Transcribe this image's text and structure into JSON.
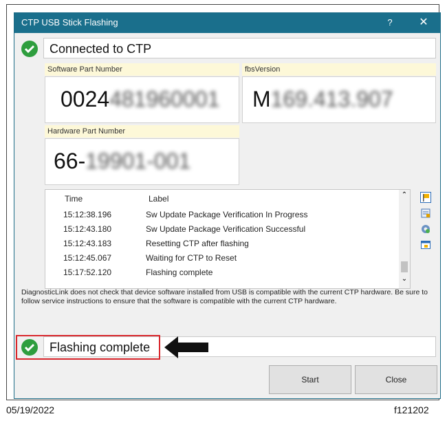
{
  "window": {
    "title": "CTP USB Stick Flashing",
    "help_label": "?",
    "close_label": "✕"
  },
  "status_top": {
    "text": "Connected to CTP"
  },
  "software_part": {
    "label": "Software Part Number",
    "value_visible": "0024",
    "value_blurred": "481960001"
  },
  "fbs_version": {
    "label": "fbsVersion",
    "value_visible": "M",
    "value_blurred": "169.413.907"
  },
  "hardware_part": {
    "label": "Hardware Part Number",
    "value_visible": "66-",
    "value_blurred": "19901-001"
  },
  "log": {
    "columns": [
      "Time",
      "Label"
    ],
    "rows": [
      {
        "time": "15:12:38.196",
        "label": "Sw Update Package Verification In Progress"
      },
      {
        "time": "15:12:43.180",
        "label": "Sw Update Package Verification Successful"
      },
      {
        "time": "15:12:43.183",
        "label": "Resetting CTP after flashing"
      },
      {
        "time": "15:12:45.067",
        "label": "Waiting for CTP to Reset"
      },
      {
        "time": "15:17:52.120",
        "label": "Flashing complete"
      }
    ],
    "scroll_up": "⌃",
    "scroll_down": "⌄"
  },
  "warning": "DiagnosticLink does not check that device software installed from USB is compatible with the current CTP hardware. Be sure to follow service instructions to ensure that the software is compatible with the current CTP hardware.",
  "status_bottom": {
    "text": "Flashing complete"
  },
  "buttons": {
    "start": "Start",
    "close": "Close"
  },
  "footer": {
    "date": "05/19/2022",
    "figure_id": "f121202"
  },
  "colors": {
    "titlebar": "#1a6f8c",
    "check": "#2e9e3e",
    "highlight": "#d9262c"
  }
}
